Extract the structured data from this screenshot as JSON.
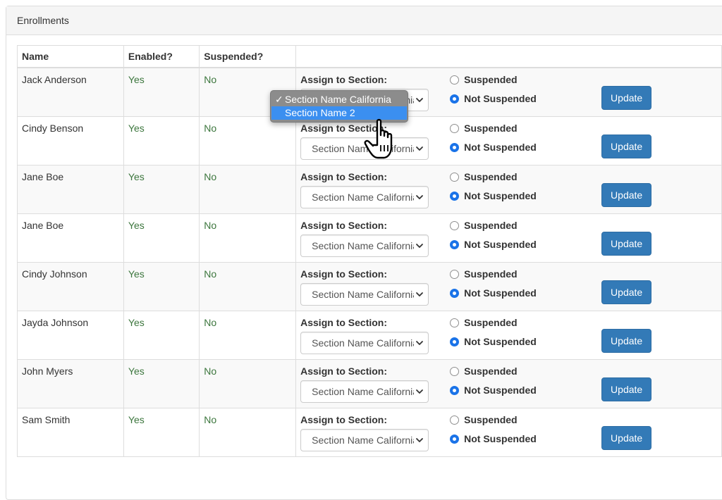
{
  "panel": {
    "title": "Enrollments"
  },
  "table": {
    "headers": {
      "name": "Name",
      "enabled": "Enabled?",
      "suspended": "Suspended?",
      "controls": ""
    },
    "assign_label": "Assign to Section:",
    "radio_suspended": "Suspended",
    "radio_not_suspended": "Not Suspended",
    "update_label": "Update",
    "select_value": "Section Name California",
    "rows": [
      {
        "name": "Jack Anderson",
        "enabled": "Yes",
        "suspended": "No"
      },
      {
        "name": "Cindy Benson",
        "enabled": "Yes",
        "suspended": "No"
      },
      {
        "name": "Jane Boe",
        "enabled": "Yes",
        "suspended": "No"
      },
      {
        "name": "Jane Boe",
        "enabled": "Yes",
        "suspended": "No"
      },
      {
        "name": "Cindy Johnson",
        "enabled": "Yes",
        "suspended": "No"
      },
      {
        "name": "Jayda Johnson",
        "enabled": "Yes",
        "suspended": "No"
      },
      {
        "name": "John Myers",
        "enabled": "Yes",
        "suspended": "No"
      },
      {
        "name": "Sam Smith",
        "enabled": "Yes",
        "suspended": "No"
      }
    ]
  },
  "dropdown": {
    "check": "✓",
    "options": [
      "Section Name California",
      "Section Name 2"
    ],
    "selected_index": 0,
    "highlighted_index": 1
  },
  "colors": {
    "accent": "#337ab7",
    "yes_no_text": "#3c763d",
    "radio_checked": "#1a73e8",
    "dropdown_bg": "#8c8c8c",
    "dropdown_highlight": "#3b8ff0"
  },
  "icons": {
    "cursor": "pointing-hand-cursor-icon",
    "select_arrow": "chevron-down-icon"
  }
}
